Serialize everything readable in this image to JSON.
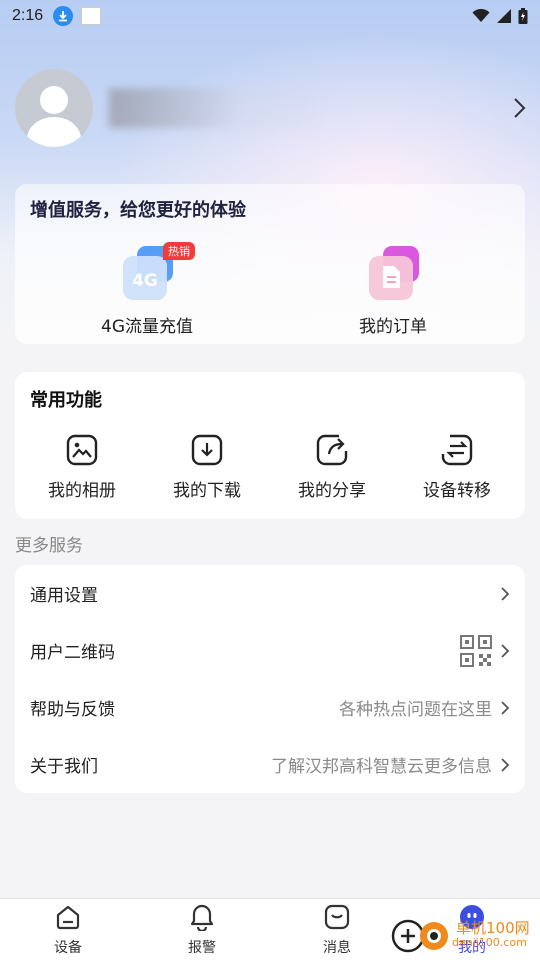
{
  "status_bar": {
    "time": "2:16"
  },
  "profile": {
    "username": "hidden"
  },
  "value_added": {
    "title": "增值服务，给您更好的体验",
    "items": [
      {
        "label": "4G流量充值",
        "icon": "sim-4g-icon",
        "badge": "热销"
      },
      {
        "label": "我的订单",
        "icon": "order-document-icon"
      }
    ]
  },
  "common_functions": {
    "title": "常用功能",
    "items": [
      {
        "label": "我的相册",
        "icon": "album-icon"
      },
      {
        "label": "我的下载",
        "icon": "download-icon"
      },
      {
        "label": "我的分享",
        "icon": "share-icon"
      },
      {
        "label": "设备转移",
        "icon": "transfer-icon"
      }
    ]
  },
  "more_services": {
    "caption": "更多服务",
    "rows": [
      {
        "title": "通用设置",
        "hint": ""
      },
      {
        "title": "用户二维码",
        "hint": ""
      },
      {
        "title": "帮助与反馈",
        "hint": "各种热点问题在这里"
      },
      {
        "title": "关于我们",
        "hint": "了解汉邦高科智慧云更多信息"
      }
    ]
  },
  "tabbar": {
    "tabs": [
      {
        "label": "设备",
        "icon": "device-icon"
      },
      {
        "label": "报警",
        "icon": "bell-icon"
      },
      {
        "label": "消息",
        "icon": "message-icon"
      },
      {
        "label": "我的",
        "icon": "profile-face-icon",
        "active": true
      }
    ]
  },
  "watermark": {
    "text": "单机100网",
    "sub": "danji100.com"
  },
  "colors": {
    "accent": "#3b4ee0",
    "badge": "#f23b3b",
    "background": "#f4f4f6"
  }
}
